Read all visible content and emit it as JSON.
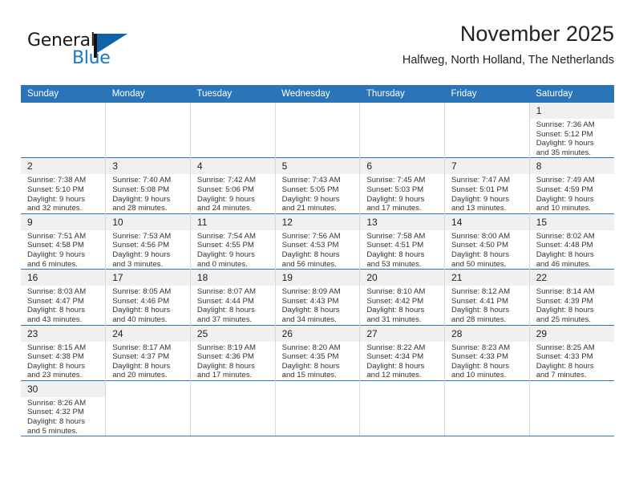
{
  "brand": {
    "name_top": "General",
    "name_bottom": "Blue",
    "accent_color": "#1163a8",
    "logo_icon": "flag-triangle-icon"
  },
  "header": {
    "title": "November 2025",
    "subtitle": "Halfweg, North Holland, The Netherlands"
  },
  "theme": {
    "header_row_bg": "#2c74b8",
    "daynum_bg": "#f0f0f0",
    "grid_line": "#2c74b8",
    "cell_divider": "#d8d8d8"
  },
  "weekday_headers": [
    "Sunday",
    "Monday",
    "Tuesday",
    "Wednesday",
    "Thursday",
    "Friday",
    "Saturday"
  ],
  "labels": {
    "sunrise_prefix": "Sunrise:",
    "sunset_prefix": "Sunset:",
    "daylight_prefix": "Daylight:"
  },
  "weeks": [
    [
      {
        "empty": true
      },
      {
        "empty": true
      },
      {
        "empty": true
      },
      {
        "empty": true
      },
      {
        "empty": true
      },
      {
        "empty": true
      },
      {
        "day": "1",
        "sunrise": "Sunrise: 7:36 AM",
        "sunset": "Sunset: 5:12 PM",
        "daylight_line1": "Daylight: 9 hours",
        "daylight_line2": "and 35 minutes."
      }
    ],
    [
      {
        "day": "2",
        "sunrise": "Sunrise: 7:38 AM",
        "sunset": "Sunset: 5:10 PM",
        "daylight_line1": "Daylight: 9 hours",
        "daylight_line2": "and 32 minutes."
      },
      {
        "day": "3",
        "sunrise": "Sunrise: 7:40 AM",
        "sunset": "Sunset: 5:08 PM",
        "daylight_line1": "Daylight: 9 hours",
        "daylight_line2": "and 28 minutes."
      },
      {
        "day": "4",
        "sunrise": "Sunrise: 7:42 AM",
        "sunset": "Sunset: 5:06 PM",
        "daylight_line1": "Daylight: 9 hours",
        "daylight_line2": "and 24 minutes."
      },
      {
        "day": "5",
        "sunrise": "Sunrise: 7:43 AM",
        "sunset": "Sunset: 5:05 PM",
        "daylight_line1": "Daylight: 9 hours",
        "daylight_line2": "and 21 minutes."
      },
      {
        "day": "6",
        "sunrise": "Sunrise: 7:45 AM",
        "sunset": "Sunset: 5:03 PM",
        "daylight_line1": "Daylight: 9 hours",
        "daylight_line2": "and 17 minutes."
      },
      {
        "day": "7",
        "sunrise": "Sunrise: 7:47 AM",
        "sunset": "Sunset: 5:01 PM",
        "daylight_line1": "Daylight: 9 hours",
        "daylight_line2": "and 13 minutes."
      },
      {
        "day": "8",
        "sunrise": "Sunrise: 7:49 AM",
        "sunset": "Sunset: 4:59 PM",
        "daylight_line1": "Daylight: 9 hours",
        "daylight_line2": "and 10 minutes."
      }
    ],
    [
      {
        "day": "9",
        "sunrise": "Sunrise: 7:51 AM",
        "sunset": "Sunset: 4:58 PM",
        "daylight_line1": "Daylight: 9 hours",
        "daylight_line2": "and 6 minutes."
      },
      {
        "day": "10",
        "sunrise": "Sunrise: 7:53 AM",
        "sunset": "Sunset: 4:56 PM",
        "daylight_line1": "Daylight: 9 hours",
        "daylight_line2": "and 3 minutes."
      },
      {
        "day": "11",
        "sunrise": "Sunrise: 7:54 AM",
        "sunset": "Sunset: 4:55 PM",
        "daylight_line1": "Daylight: 9 hours",
        "daylight_line2": "and 0 minutes."
      },
      {
        "day": "12",
        "sunrise": "Sunrise: 7:56 AM",
        "sunset": "Sunset: 4:53 PM",
        "daylight_line1": "Daylight: 8 hours",
        "daylight_line2": "and 56 minutes."
      },
      {
        "day": "13",
        "sunrise": "Sunrise: 7:58 AM",
        "sunset": "Sunset: 4:51 PM",
        "daylight_line1": "Daylight: 8 hours",
        "daylight_line2": "and 53 minutes."
      },
      {
        "day": "14",
        "sunrise": "Sunrise: 8:00 AM",
        "sunset": "Sunset: 4:50 PM",
        "daylight_line1": "Daylight: 8 hours",
        "daylight_line2": "and 50 minutes."
      },
      {
        "day": "15",
        "sunrise": "Sunrise: 8:02 AM",
        "sunset": "Sunset: 4:48 PM",
        "daylight_line1": "Daylight: 8 hours",
        "daylight_line2": "and 46 minutes."
      }
    ],
    [
      {
        "day": "16",
        "sunrise": "Sunrise: 8:03 AM",
        "sunset": "Sunset: 4:47 PM",
        "daylight_line1": "Daylight: 8 hours",
        "daylight_line2": "and 43 minutes."
      },
      {
        "day": "17",
        "sunrise": "Sunrise: 8:05 AM",
        "sunset": "Sunset: 4:46 PM",
        "daylight_line1": "Daylight: 8 hours",
        "daylight_line2": "and 40 minutes."
      },
      {
        "day": "18",
        "sunrise": "Sunrise: 8:07 AM",
        "sunset": "Sunset: 4:44 PM",
        "daylight_line1": "Daylight: 8 hours",
        "daylight_line2": "and 37 minutes."
      },
      {
        "day": "19",
        "sunrise": "Sunrise: 8:09 AM",
        "sunset": "Sunset: 4:43 PM",
        "daylight_line1": "Daylight: 8 hours",
        "daylight_line2": "and 34 minutes."
      },
      {
        "day": "20",
        "sunrise": "Sunrise: 8:10 AM",
        "sunset": "Sunset: 4:42 PM",
        "daylight_line1": "Daylight: 8 hours",
        "daylight_line2": "and 31 minutes."
      },
      {
        "day": "21",
        "sunrise": "Sunrise: 8:12 AM",
        "sunset": "Sunset: 4:41 PM",
        "daylight_line1": "Daylight: 8 hours",
        "daylight_line2": "and 28 minutes."
      },
      {
        "day": "22",
        "sunrise": "Sunrise: 8:14 AM",
        "sunset": "Sunset: 4:39 PM",
        "daylight_line1": "Daylight: 8 hours",
        "daylight_line2": "and 25 minutes."
      }
    ],
    [
      {
        "day": "23",
        "sunrise": "Sunrise: 8:15 AM",
        "sunset": "Sunset: 4:38 PM",
        "daylight_line1": "Daylight: 8 hours",
        "daylight_line2": "and 23 minutes."
      },
      {
        "day": "24",
        "sunrise": "Sunrise: 8:17 AM",
        "sunset": "Sunset: 4:37 PM",
        "daylight_line1": "Daylight: 8 hours",
        "daylight_line2": "and 20 minutes."
      },
      {
        "day": "25",
        "sunrise": "Sunrise: 8:19 AM",
        "sunset": "Sunset: 4:36 PM",
        "daylight_line1": "Daylight: 8 hours",
        "daylight_line2": "and 17 minutes."
      },
      {
        "day": "26",
        "sunrise": "Sunrise: 8:20 AM",
        "sunset": "Sunset: 4:35 PM",
        "daylight_line1": "Daylight: 8 hours",
        "daylight_line2": "and 15 minutes."
      },
      {
        "day": "27",
        "sunrise": "Sunrise: 8:22 AM",
        "sunset": "Sunset: 4:34 PM",
        "daylight_line1": "Daylight: 8 hours",
        "daylight_line2": "and 12 minutes."
      },
      {
        "day": "28",
        "sunrise": "Sunrise: 8:23 AM",
        "sunset": "Sunset: 4:33 PM",
        "daylight_line1": "Daylight: 8 hours",
        "daylight_line2": "and 10 minutes."
      },
      {
        "day": "29",
        "sunrise": "Sunrise: 8:25 AM",
        "sunset": "Sunset: 4:33 PM",
        "daylight_line1": "Daylight: 8 hours",
        "daylight_line2": "and 7 minutes."
      }
    ],
    [
      {
        "day": "30",
        "sunrise": "Sunrise: 8:26 AM",
        "sunset": "Sunset: 4:32 PM",
        "daylight_line1": "Daylight: 8 hours",
        "daylight_line2": "and 5 minutes."
      },
      {
        "empty": true
      },
      {
        "empty": true
      },
      {
        "empty": true
      },
      {
        "empty": true
      },
      {
        "empty": true
      },
      {
        "empty": true
      }
    ]
  ]
}
